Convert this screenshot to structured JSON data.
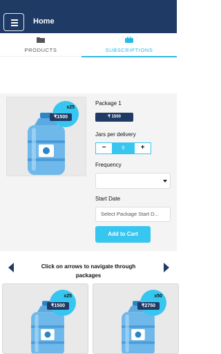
{
  "header": {
    "title": "Home"
  },
  "tabs": [
    {
      "label": "PRODUCTS",
      "icon": "folder-icon",
      "active": false
    },
    {
      "label": "SUBSCRIPTIONS",
      "icon": "briefcase-icon",
      "active": true
    }
  ],
  "product": {
    "badge_qty": "x25",
    "badge_price": "₹1500",
    "package_title": "Package 1",
    "price": "₹ 1500",
    "jars_label": "Jars per delivery",
    "jars_value": "0",
    "minus_label": "−",
    "plus_label": "+",
    "frequency_label": "Frequency",
    "frequency_value": "",
    "start_date_label": "Start Date",
    "start_date_placeholder": "Select Package Start D...",
    "add_to_cart_label": "Add to Cart"
  },
  "carousel": {
    "hint": "Click on arrows to navigate through packages",
    "cards": [
      {
        "qty": "x25",
        "price": "₹1500"
      },
      {
        "qty": "x50",
        "price": "₹2750"
      }
    ]
  },
  "colors": {
    "primary": "#1f3a64",
    "accent": "#37c6f0",
    "tab_active": "#2bb8e6",
    "panel_bg": "#f4f4f4"
  }
}
